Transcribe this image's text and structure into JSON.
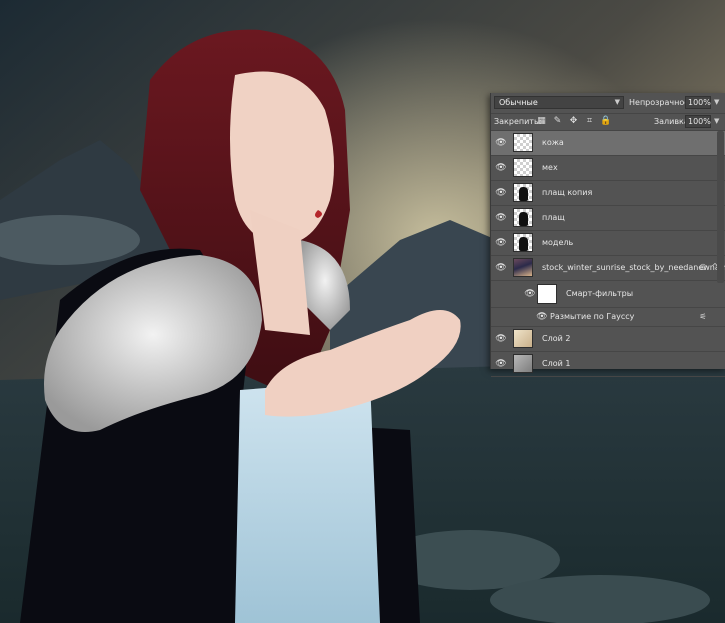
{
  "panel": {
    "blend_mode": "Обычные",
    "opacity_label": "Непрозрачность:",
    "opacity_value": "100%",
    "lock_label": "Закрепить:",
    "fill_label": "Заливка:",
    "fill_value": "100%"
  },
  "layers": [
    {
      "name": "кожа",
      "thumb": "transparent",
      "selected": true
    },
    {
      "name": "мех",
      "thumb": "transparent"
    },
    {
      "name": "плащ копия",
      "thumb": "figure"
    },
    {
      "name": "плащ",
      "thumb": "figure"
    },
    {
      "name": "модель",
      "thumb": "figure"
    },
    {
      "name": "stock_winter_sunrise_stock_by_needanewname",
      "thumb": "photo",
      "smart": true
    },
    {
      "name": "Смарт-фильтры",
      "type": "smart-filters"
    },
    {
      "name": "Размытие по Гауссу",
      "type": "filter"
    },
    {
      "name": "Слой 2",
      "thumb": "beige"
    },
    {
      "name": "Слой 1",
      "thumb": "gray"
    }
  ],
  "icons": {
    "visibility": "eye-icon",
    "lock_pixels": "checkerboard-lock-icon",
    "lock_brush": "brush-lock-icon",
    "lock_move": "move-lock-icon",
    "lock_artboard": "artboard-lock-icon",
    "lock_all": "padlock-icon"
  },
  "colors": {
    "panel_bg": "#535353",
    "selected_row": "#6f6f6f",
    "text": "#e6e6e6"
  }
}
